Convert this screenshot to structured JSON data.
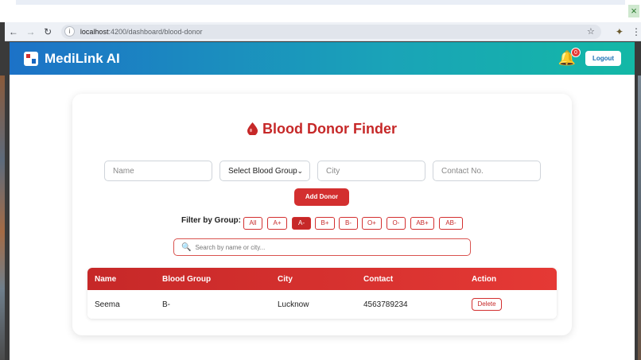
{
  "browser": {
    "url_host": "localhost",
    "url_path": ":4200/dashboard/blood-donor"
  },
  "header": {
    "brand": "MediLink AI",
    "notification_count": "0",
    "logout_label": "Logout"
  },
  "finder": {
    "title": "Blood Donor Finder",
    "name_placeholder": "Name",
    "blood_group_selected": "Select Blood Group",
    "city_placeholder": "City",
    "contact_placeholder": "Contact No.",
    "add_label": "Add Donor",
    "filter_label": "Filter by Group:",
    "filters": [
      "All",
      "A+",
      "A-",
      "B+",
      "B-",
      "O+",
      "O-",
      "AB+",
      "AB-"
    ],
    "active_filter": "A-",
    "search_placeholder": "Search by name or city..."
  },
  "table": {
    "columns": [
      "Name",
      "Blood Group",
      "City",
      "Contact",
      "Action"
    ],
    "rows": [
      {
        "name": "Seema",
        "blood_group": "B-",
        "city": "Lucknow",
        "contact": "4563789234",
        "action": "Delete"
      }
    ]
  },
  "colors": {
    "accent": "#c62828",
    "header_start": "#1c72c7",
    "header_end": "#13b8a6"
  }
}
